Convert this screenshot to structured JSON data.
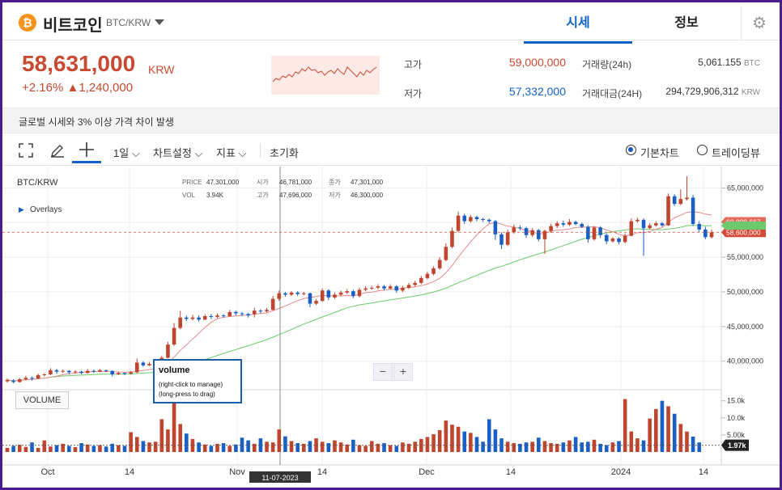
{
  "coin": {
    "icon": "bitcoin-icon",
    "symbol_glyph": "₿",
    "name": "비트코인",
    "pair": "BTC/KRW"
  },
  "tabs": [
    {
      "label": "시세",
      "active": true
    },
    {
      "label": "정보",
      "active": false
    }
  ],
  "settings_icon": "gear-icon",
  "ticker": {
    "price": "58,631,000",
    "unit": "KRW",
    "change_pct": "+2.16%",
    "change_arrow": "▲",
    "change_amount": "1,240,000",
    "stats": [
      {
        "label": "고가",
        "value": "59,000,000",
        "color": "#c84a31"
      },
      {
        "label": "저가",
        "value": "57,332,000",
        "color": "#1261c4"
      }
    ],
    "volume": {
      "label": "거래량(24h)",
      "value": "5,061.155",
      "unit": "BTC"
    },
    "trade_value": {
      "label": "거래대금(24H)",
      "value": "294,729,906,312",
      "unit": "KRW"
    }
  },
  "notice": "글로벌 시세와 3% 이상 가격 차이 발생",
  "toolbar": {
    "fullscreen_icon": "fullscreen-icon",
    "draw_icon": "pencil-icon",
    "crosshair_icon": "crosshair-icon",
    "interval": "1일",
    "chart_settings": "차트설정",
    "indicators": "지표",
    "reset": "초기화",
    "chart_modes": [
      {
        "label": "기본차트",
        "selected": true
      },
      {
        "label": "트레이딩뷰",
        "selected": false
      }
    ]
  },
  "chart_data": {
    "type": "candlestick",
    "symbol": "BTC/KRW",
    "overlays_label": "Overlays",
    "legend": {
      "price_label": "PRICE",
      "price": "47,301,000",
      "vol_label": "VOL",
      "vol": "3.94K",
      "open_label": "시가",
      "open": "46,781,000",
      "high_label": "고가",
      "high": "47,696,000",
      "close_label": "종가",
      "close": "47,301,000",
      "low_label": "저가",
      "low": "46,300,000"
    },
    "y_ticks": [
      "65,000,000",
      "60,000,000",
      "55,000,000",
      "50,000,000",
      "45,000,000",
      "40,000,000"
    ],
    "y_tick_values": [
      65000000,
      60000000,
      55000000,
      50000000,
      45000000,
      40000000
    ],
    "ylim": [
      36000000,
      67500000
    ],
    "x_ticks": [
      "Oct",
      "14",
      "Nov",
      "14",
      "Dec",
      "14",
      "2024",
      "14"
    ],
    "crosshair_date": "11-07-2023",
    "price_tags": [
      {
        "label": "60,098,667",
        "value": 60098667,
        "color": "#e26a5a"
      },
      {
        "label": "58,600,000",
        "value": 58600000,
        "color": "#d64a3a"
      }
    ],
    "ma_colors": {
      "short": "#e48a8a",
      "long": "#6cc96c"
    },
    "up_color": "#c0452e",
    "down_color": "#1a5fc4",
    "volume_panel": {
      "label": "VOLUME",
      "y_ticks": [
        "15.0k",
        "10.0k",
        "5.00k"
      ],
      "y_tick_values": [
        15000,
        10000,
        5000
      ],
      "ylim": [
        0,
        18000
      ],
      "current_label": "1.97k",
      "current": 1970
    },
    "candles": [
      [
        37.1,
        37.3,
        37.5,
        36.9
      ],
      [
        37.2,
        37.0,
        37.4,
        36.8
      ],
      [
        37.0,
        37.4,
        37.6,
        36.9
      ],
      [
        37.4,
        37.6,
        37.9,
        37.2
      ],
      [
        37.6,
        37.5,
        37.8,
        37.2
      ],
      [
        37.5,
        38.0,
        38.2,
        37.4
      ],
      [
        38.0,
        38.1,
        38.3,
        37.8
      ],
      [
        38.1,
        38.7,
        39.0,
        38.0
      ],
      [
        38.7,
        38.5,
        38.9,
        38.2
      ],
      [
        38.5,
        38.6,
        38.8,
        38.3
      ],
      [
        38.6,
        38.4,
        38.7,
        38.1
      ],
      [
        38.4,
        38.5,
        38.7,
        38.2
      ],
      [
        38.5,
        38.3,
        38.6,
        38.1
      ],
      [
        38.3,
        38.6,
        38.9,
        38.2
      ],
      [
        38.6,
        38.5,
        38.8,
        38.3
      ],
      [
        38.5,
        38.7,
        38.9,
        38.4
      ],
      [
        38.7,
        38.6,
        38.8,
        38.4
      ],
      [
        38.6,
        38.1,
        38.7,
        37.8
      ],
      [
        38.1,
        38.3,
        38.5,
        38.0
      ],
      [
        38.3,
        38.2,
        38.4,
        38.0
      ],
      [
        38.2,
        38.4,
        38.6,
        38.1
      ],
      [
        38.4,
        39.8,
        40.4,
        38.3
      ],
      [
        39.8,
        39.4,
        40.0,
        39.2
      ],
      [
        39.4,
        39.6,
        39.9,
        39.3
      ],
      [
        39.6,
        39.7,
        39.9,
        39.5
      ],
      [
        39.7,
        40.5,
        40.8,
        39.6
      ],
      [
        40.5,
        42.4,
        42.8,
        40.4
      ],
      [
        42.4,
        44.8,
        45.5,
        42.2
      ],
      [
        44.8,
        46.3,
        47.2,
        44.6
      ],
      [
        46.3,
        46.1,
        46.6,
        45.8
      ],
      [
        46.1,
        46.3,
        46.7,
        45.9
      ],
      [
        46.3,
        46.0,
        46.6,
        45.7
      ],
      [
        46.0,
        46.5,
        46.8,
        45.9
      ],
      [
        46.5,
        46.4,
        46.8,
        46.1
      ],
      [
        46.4,
        46.6,
        46.9,
        46.2
      ],
      [
        46.6,
        46.5,
        46.8,
        46.3
      ],
      [
        46.5,
        47.1,
        47.4,
        46.4
      ],
      [
        47.1,
        46.9,
        47.3,
        46.6
      ],
      [
        46.9,
        46.8,
        47.1,
        46.5
      ],
      [
        46.8,
        46.6,
        47.0,
        46.3
      ],
      [
        46.8,
        47.3,
        47.7,
        46.3
      ],
      [
        47.3,
        47.2,
        47.5,
        46.9
      ],
      [
        47.2,
        47.4,
        47.7,
        47.0
      ],
      [
        47.4,
        49.0,
        49.4,
        47.3
      ],
      [
        49.0,
        49.8,
        50.2,
        48.7
      ],
      [
        49.8,
        49.6,
        50.0,
        49.3
      ],
      [
        49.6,
        49.9,
        50.1,
        49.4
      ],
      [
        49.9,
        49.7,
        50.1,
        49.4
      ],
      [
        49.7,
        49.8,
        50.0,
        49.5
      ],
      [
        49.8,
        48.3,
        49.9,
        47.8
      ],
      [
        48.3,
        48.7,
        49.0,
        48.1
      ],
      [
        48.7,
        50.2,
        50.5,
        48.6
      ],
      [
        50.2,
        49.2,
        50.4,
        48.8
      ],
      [
        49.2,
        49.6,
        49.9,
        49.0
      ],
      [
        49.6,
        49.9,
        50.2,
        49.4
      ],
      [
        49.9,
        50.1,
        50.4,
        49.7
      ],
      [
        50.1,
        49.4,
        50.3,
        49.1
      ],
      [
        49.4,
        50.3,
        50.6,
        49.2
      ],
      [
        50.3,
        50.5,
        50.8,
        50.1
      ],
      [
        50.5,
        50.6,
        50.9,
        50.3
      ],
      [
        50.6,
        50.8,
        51.1,
        50.4
      ],
      [
        50.8,
        50.5,
        51.0,
        50.2
      ],
      [
        50.5,
        50.8,
        51.1,
        50.3
      ],
      [
        50.8,
        50.2,
        51.0,
        49.9
      ],
      [
        50.2,
        50.6,
        50.9,
        50.0
      ],
      [
        50.6,
        51.0,
        51.3,
        50.4
      ],
      [
        51.0,
        51.3,
        51.6,
        50.8
      ],
      [
        51.3,
        52.0,
        52.3,
        51.1
      ],
      [
        52.0,
        52.6,
        52.9,
        51.8
      ],
      [
        52.6,
        53.4,
        53.7,
        52.4
      ],
      [
        53.4,
        54.6,
        55.0,
        53.2
      ],
      [
        54.6,
        56.5,
        57.0,
        54.4
      ],
      [
        56.5,
        58.8,
        59.3,
        56.3
      ],
      [
        58.8,
        61.0,
        61.6,
        58.6
      ],
      [
        61.0,
        60.2,
        61.3,
        59.8
      ],
      [
        60.2,
        60.8,
        61.1,
        60.0
      ],
      [
        60.8,
        60.5,
        61.0,
        60.2
      ],
      [
        60.5,
        60.4,
        60.7,
        60.1
      ],
      [
        60.4,
        60.2,
        60.6,
        59.9
      ],
      [
        60.2,
        58.3,
        60.4,
        57.5
      ],
      [
        58.3,
        56.8,
        58.6,
        56.2
      ],
      [
        56.8,
        58.6,
        59.0,
        56.6
      ],
      [
        58.6,
        59.3,
        59.7,
        58.4
      ],
      [
        59.3,
        59.2,
        59.6,
        58.9
      ],
      [
        59.2,
        58.2,
        59.4,
        57.8
      ],
      [
        58.2,
        58.9,
        59.2,
        57.9
      ],
      [
        58.9,
        57.6,
        59.1,
        57.3
      ],
      [
        57.6,
        58.8,
        59.0,
        55.5
      ],
      [
        58.8,
        59.5,
        59.8,
        58.5
      ],
      [
        59.5,
        59.9,
        60.2,
        59.2
      ],
      [
        59.9,
        59.7,
        60.3,
        59.4
      ],
      [
        59.7,
        60.1,
        60.5,
        59.5
      ],
      [
        60.1,
        59.8,
        60.3,
        59.6
      ],
      [
        59.8,
        59.4,
        60.0,
        59.2
      ],
      [
        59.4,
        57.6,
        59.6,
        57.1
      ],
      [
        57.6,
        59.3,
        59.5,
        57.4
      ],
      [
        59.3,
        58.2,
        59.5,
        57.8
      ],
      [
        58.2,
        57.3,
        58.4,
        56.9
      ],
      [
        57.3,
        57.7,
        57.9,
        57.1
      ],
      [
        57.7,
        57.2,
        57.9,
        56.9
      ],
      [
        57.2,
        58.1,
        58.4,
        57.0
      ],
      [
        58.1,
        60.2,
        60.6,
        58.0
      ],
      [
        60.2,
        60.4,
        60.7,
        60.0
      ],
      [
        60.4,
        59.2,
        60.6,
        55.2
      ],
      [
        59.2,
        59.6,
        59.9,
        59.0
      ],
      [
        59.6,
        59.9,
        60.2,
        59.4
      ],
      [
        59.9,
        59.6,
        60.1,
        59.4
      ],
      [
        59.6,
        63.8,
        64.2,
        59.5
      ],
      [
        63.8,
        62.7,
        64.1,
        62.4
      ],
      [
        62.7,
        63.4,
        64.8,
        62.5
      ],
      [
        63.4,
        63.6,
        66.7,
        63.2
      ],
      [
        63.6,
        59.8,
        64.0,
        59.5
      ],
      [
        59.8,
        59.0,
        60.2,
        58.6
      ],
      [
        59.0,
        57.9,
        59.4,
        57.6
      ],
      [
        57.9,
        58.6,
        59.0,
        57.7
      ]
    ],
    "volumes": [
      1.2,
      1.8,
      2.1,
      1.5,
      2.8,
      1.2,
      3.4,
      1.6,
      2.0,
      2.4,
      1.8,
      1.4,
      2.6,
      2.2,
      1.8,
      2.0,
      1.6,
      2.4,
      2.0,
      1.8,
      5.8,
      4.4,
      3.2,
      2.8,
      3.0,
      9.6,
      6.6,
      14.6,
      8.2,
      5.4,
      3.8,
      2.8,
      2.2,
      1.8,
      2.4,
      2.6,
      1.8,
      2.2,
      4.2,
      3.4,
      2.4,
      4.0,
      3.0,
      2.8,
      6.6,
      4.6,
      3.2,
      2.6,
      2.4,
      3.2,
      4.0,
      3.0,
      2.6,
      3.4,
      2.8,
      2.2,
      3.6,
      2.0,
      1.8,
      3.2,
      2.4,
      2.6,
      2.0,
      1.8,
      2.8,
      2.4,
      3.0,
      3.8,
      4.4,
      5.2,
      6.4,
      9.2,
      8.0,
      7.4,
      6.0,
      5.6,
      4.4,
      3.0,
      9.6,
      6.6,
      4.0,
      3.0,
      2.6,
      2.4,
      2.8,
      3.0,
      4.2,
      3.2,
      2.6,
      2.4,
      2.8,
      3.4,
      4.4,
      2.8,
      3.0,
      3.6,
      2.4,
      2.0,
      2.8,
      3.2,
      15.5,
      6.0,
      4.0,
      3.4,
      9.8,
      12.6,
      15.0,
      13.4,
      11.2,
      8.2,
      6.0,
      4.5,
      2.8
    ]
  }
}
